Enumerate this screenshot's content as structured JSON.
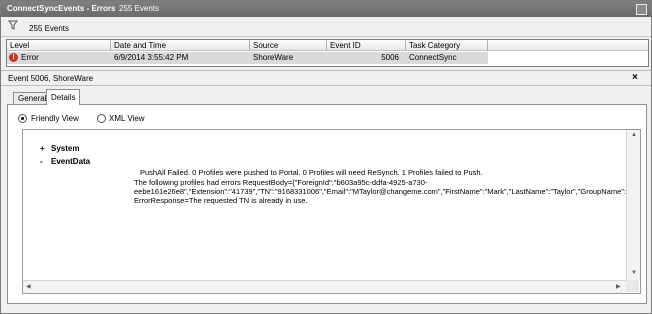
{
  "window": {
    "title": "ConnectSyncEvents - Errors",
    "count_label": "255 Events"
  },
  "filter": {
    "count_label": "255 Events"
  },
  "grid": {
    "headers": [
      "Level",
      "Date and Time",
      "Source",
      "Event ID",
      "Task Category"
    ],
    "rows": [
      {
        "level": "Error",
        "datetime": "6/9/2014 3:55:42 PM",
        "source": "ShoreWare",
        "event_id": "5006",
        "task_category": "ConnectSync"
      }
    ]
  },
  "detail": {
    "title": "Event 5006, ShoreWare",
    "close_glyph": "×",
    "tabs": [
      "General",
      "Details"
    ],
    "active_tab": "Details",
    "view_options": [
      {
        "label": "Friendly View",
        "selected": true
      },
      {
        "label": "XML View",
        "selected": false
      }
    ],
    "tree": {
      "system_toggle": "+",
      "system_label": "System",
      "eventdata_toggle": "-",
      "eventdata_label": "EventData"
    },
    "message_lines": [
      "PushAll Failed. 0 Profiles were pushed to Portal. 0 Profiles will need ReSynch. 1 Profiles failed to Push.",
      "The following profiles had errors RequestBody={\"ForeignId\":\"b603a95c-ddfa-4925-a730-",
      "eebe161e26e8\",\"Extension\":\"41739\",\"TN\":\"9168331006\",\"Email\":\"MTaylor@changeme.com\",\"FirstName\":\"Mark\",\"LastName\":\"Taylor\",\"GroupName\":\"E",
      "ErrorResponse=The requested TN is already in use."
    ]
  },
  "icons": {
    "filter": "filter-icon",
    "error": "error-icon",
    "restore": "restore-icon",
    "close": "close-icon",
    "scroll_up": "▲",
    "scroll_down": "▼",
    "scroll_left": "◀",
    "scroll_right": "▶"
  }
}
